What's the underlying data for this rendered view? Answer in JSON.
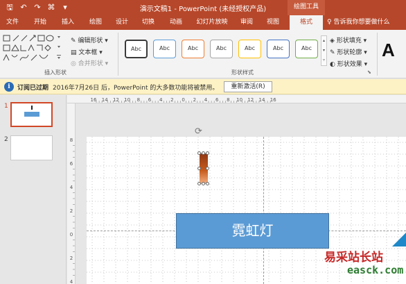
{
  "window": {
    "title": "演示文稿1 - PowerPoint (未经授权产品)",
    "context_tab_group": "绘图工具",
    "brand_color": "#b7472a"
  },
  "qat": {
    "icons": [
      "save-icon",
      "undo-icon",
      "redo-icon",
      "touch-mode-icon",
      "customize-icon"
    ],
    "glyphs": [
      "🖫",
      "↶",
      "↷",
      "⌘",
      "▾"
    ]
  },
  "tabs": [
    {
      "label": "文件",
      "active": false
    },
    {
      "label": "开始",
      "active": false
    },
    {
      "label": "插入",
      "active": false
    },
    {
      "label": "绘图",
      "active": false
    },
    {
      "label": "设计",
      "active": false
    },
    {
      "label": "切换",
      "active": false
    },
    {
      "label": "动画",
      "active": false
    },
    {
      "label": "幻灯片放映",
      "active": false
    },
    {
      "label": "审阅",
      "active": false
    },
    {
      "label": "视图",
      "active": false
    },
    {
      "label": "格式",
      "active": true
    }
  ],
  "tell_me": "♀ 告诉我你想要做什么",
  "ribbon": {
    "insert_shapes": {
      "label": "插入形状",
      "edit_shape": "编辑形状",
      "text_box": "文本框",
      "merge_shapes": "合并形状"
    },
    "shape_styles": {
      "label": "形状样式",
      "abc_label": "Abc",
      "style_colors": [
        "#3a3a3a",
        "#5b9bd5",
        "#ed7d31",
        "#a5a5a5",
        "#ffc000",
        "#4472c4",
        "#70ad47"
      ],
      "fill": "形状填充",
      "outline": "形状轮廓",
      "effects": "形状效果"
    },
    "wordart": {
      "preview": "A"
    }
  },
  "notice": {
    "title": "订阅已过期",
    "message": "2016年7月26日 后，PowerPoint 的大多数功能将被禁用。",
    "button": "重新激活(R)"
  },
  "thumbnails": [
    {
      "number": "1",
      "active": true
    },
    {
      "number": "2",
      "active": false
    }
  ],
  "ruler": {
    "h_labels": [
      "16",
      "14",
      "12",
      "10",
      "8",
      "6",
      "4",
      "2",
      "0",
      "2",
      "4",
      "6",
      "8",
      "10",
      "12",
      "14",
      "16"
    ],
    "v_labels": [
      "8",
      "6",
      "4",
      "2",
      "0",
      "2",
      "4"
    ]
  },
  "slide": {
    "rect_text": "霓虹灯",
    "rect_color": "#5b9bd5"
  },
  "watermark": {
    "cn": "易采站长站",
    "en": "easck.com"
  }
}
